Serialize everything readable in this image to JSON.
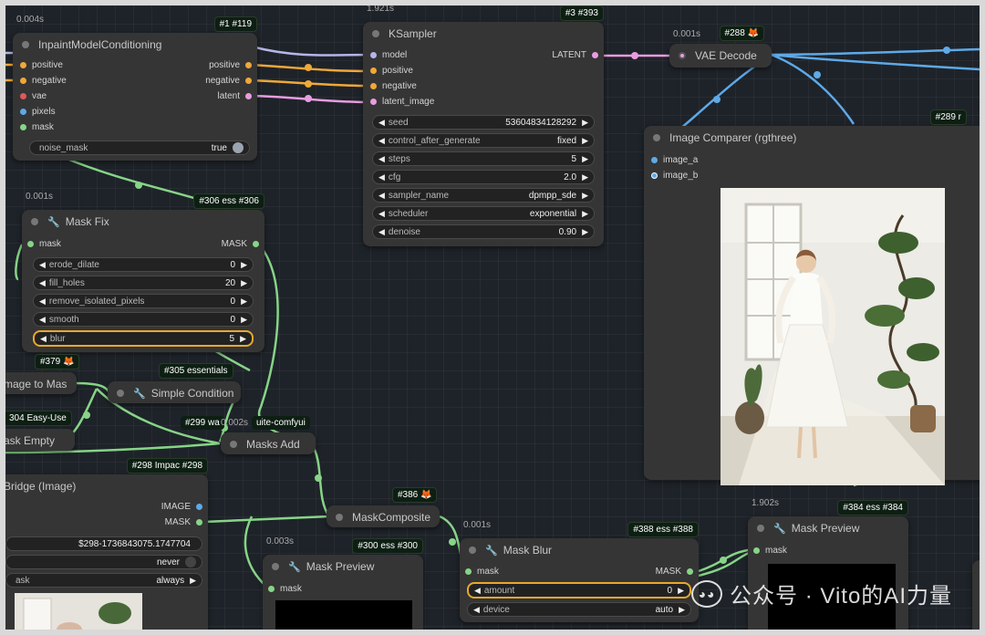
{
  "nodes": {
    "inpaint": {
      "time": "0.004s",
      "badge": "#1 #119",
      "title": "InpaintModelConditioning",
      "inputs": [
        "positive",
        "negative",
        "vae",
        "pixels",
        "mask"
      ],
      "outputs": [
        "positive",
        "negative",
        "latent"
      ],
      "widget_label": "noise_mask",
      "widget_value": "true"
    },
    "ksampler": {
      "time": "1.921s",
      "badge": "#3 #393",
      "title": "KSampler",
      "inputs": [
        "model",
        "positive",
        "negative",
        "latent_image"
      ],
      "output": "LATENT",
      "widgets": [
        {
          "label": "seed",
          "value": "53604834128292"
        },
        {
          "label": "control_after_generate",
          "value": "fixed"
        },
        {
          "label": "steps",
          "value": "5"
        },
        {
          "label": "cfg",
          "value": "2.0"
        },
        {
          "label": "sampler_name",
          "value": "dpmpp_sde"
        },
        {
          "label": "scheduler",
          "value": "exponential"
        },
        {
          "label": "denoise",
          "value": "0.90"
        }
      ]
    },
    "vae_decode": {
      "time": "0.001s",
      "badge": "#288",
      "title": "VAE Decode"
    },
    "comparer": {
      "badge": "#289 r",
      "title": "Image Comparer (rgthree)",
      "inputs": [
        "image_a",
        "image_b"
      ]
    },
    "mask_fix": {
      "time": "0.001s",
      "badge": "#306 ess #306",
      "title": "Mask Fix",
      "input": "mask",
      "output": "MASK",
      "widgets": [
        {
          "label": "erode_dilate",
          "value": "0"
        },
        {
          "label": "fill_holes",
          "value": "20"
        },
        {
          "label": "remove_isolated_pixels",
          "value": "0"
        },
        {
          "label": "smooth",
          "value": "0"
        },
        {
          "label": "blur",
          "value": "5"
        }
      ]
    },
    "image_to_mask": {
      "badge": "#379",
      "title": "mage to Mas"
    },
    "simple_condition": {
      "badge": "#305 essentials",
      "title": "Simple Condition"
    },
    "mask_empty": {
      "badge": "304 Easy-Use",
      "title": "ask Empty"
    },
    "masks_add": {
      "badge": "#299 wa",
      "time": "0.002s",
      "extra": "uite-comfyui",
      "title": "Masks Add"
    },
    "bridge": {
      "badge": "#298 Impac #298",
      "title": "Bridge (Image)",
      "outputs": [
        "IMAGE",
        "MASK"
      ],
      "widgets": [
        {
          "label": "",
          "value": "$298-1736843075.1747704"
        },
        {
          "label": "",
          "value": "never"
        },
        {
          "label": "ask",
          "value": "always"
        }
      ]
    },
    "mask_composite": {
      "badge": "#386",
      "title": "MaskComposite"
    },
    "mask_preview_1": {
      "time": "0.003s",
      "badge": "#300 ess #300",
      "title": "Mask Preview",
      "input": "mask"
    },
    "mask_blur": {
      "time": "0.001s",
      "badge": "#388 ess #388",
      "title": "Mask Blur",
      "input": "mask",
      "output": "MASK",
      "widgets": [
        {
          "label": "amount",
          "value": "0"
        },
        {
          "label": "device",
          "value": "auto"
        }
      ]
    },
    "mask_preview_2": {
      "time": "1.902s",
      "badge": "#384 ess #384",
      "title": "Mask Preview",
      "input": "mask"
    }
  },
  "watermark": "公众号 · Vito的AI力量",
  "colors": {
    "canvas": "#1e2329",
    "node": "#353535",
    "wire_cyan": "#5ea9e8",
    "wire_yellow": "#f0a838",
    "wire_pink": "#e89ce0",
    "wire_green": "#87d487",
    "wire_lavender": "#b5b5e8",
    "selected": "#e8a92e"
  }
}
